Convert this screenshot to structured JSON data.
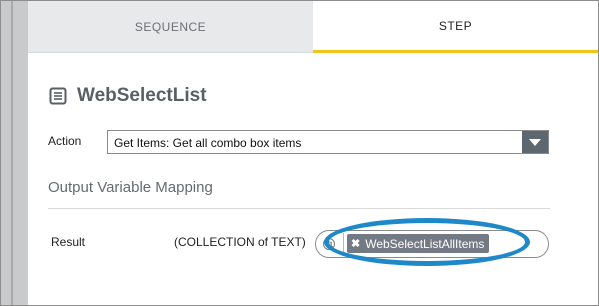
{
  "tabs": {
    "sequence_label": "SEQUENCE",
    "step_label": "STEP"
  },
  "step": {
    "title": "WebSelectList",
    "icon": "list-document-icon"
  },
  "action": {
    "label": "Action",
    "selected_value": "Get Items: Get all combo box items",
    "dropdown_icon": "chevron-down-icon"
  },
  "output_mapping": {
    "section_title": "Output Variable Mapping",
    "result_label": "Result",
    "result_type": "(COLLECTION of TEXT)",
    "variable_icon": "at-sign-icon",
    "variable_chip": "WebSelectListAllItems",
    "chip_remove_icon": "close-icon"
  },
  "colors": {
    "active_tab_underline": "#f2c318",
    "highlight_ellipse": "#1e88c9",
    "chip_background": "#737a83"
  }
}
